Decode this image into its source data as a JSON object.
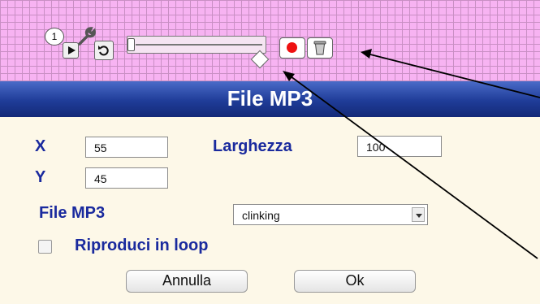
{
  "widget": {
    "badge": "1",
    "icons": [
      "play-icon",
      "wrench-icon",
      "undo-icon",
      "record-icon",
      "trash-icon"
    ],
    "record_color": "#ee1111"
  },
  "dialog": {
    "title": "File MP3",
    "x_label": "X",
    "x_value": "55",
    "y_label": "Y",
    "y_value": "45",
    "width_label": "Larghezza",
    "width_value": "100",
    "file_label": "File MP3",
    "file_selected": "clinking",
    "loop_label": "Riproduci in loop",
    "loop_checked": false,
    "cancel_label": "Annulla",
    "ok_label": "Ok"
  },
  "colors": {
    "header": "#1f3c98",
    "label": "#1a2a9e",
    "canvas": "#f7b3f2"
  }
}
